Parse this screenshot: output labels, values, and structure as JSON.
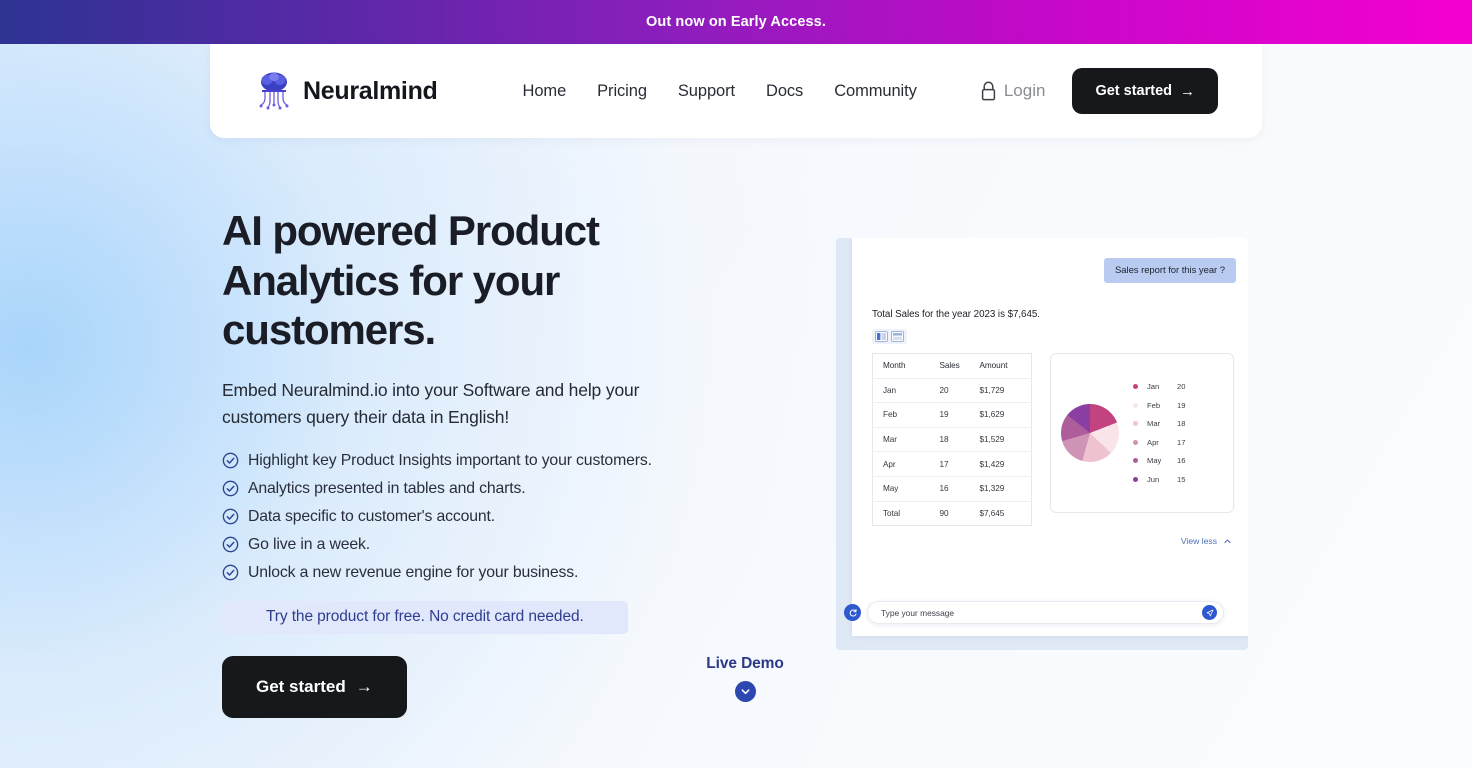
{
  "banner": {
    "text": "Out now on Early Access."
  },
  "header": {
    "brand": "Neuralmind",
    "logo_icon": "brain-circuit-logo",
    "nav": [
      {
        "label": "Home"
      },
      {
        "label": "Pricing"
      },
      {
        "label": "Support"
      },
      {
        "label": "Docs"
      },
      {
        "label": "Community"
      }
    ],
    "login_label": "Login",
    "login_icon": "lock-icon",
    "cta_label": "Get started",
    "cta_arrow": "→"
  },
  "hero": {
    "headline": "AI powered Product Analytics for your customers.",
    "subhead": "Embed Neuralmind.io into your Software and help your customers query their data in English!",
    "features": [
      "Highlight key Product Insights important to your customers.",
      "Analytics presented in tables and charts.",
      "Data specific to customer's account.",
      "Go live in a week.",
      "Unlock a new revenue engine for your business."
    ],
    "promo": "Try the product for free. No credit card needed.",
    "cta_label": "Get started",
    "cta_arrow": "→"
  },
  "live_demo": {
    "label": "Live Demo",
    "scroll_icon": "chevron-down-icon"
  },
  "demo": {
    "user_message": "Sales report for this year ?",
    "answer": "Total Sales for the year 2023 is $7,645.",
    "toggle_chart_icon": "columns-view-icon",
    "toggle_table_icon": "table-view-icon",
    "view_less_label": "View less",
    "view_less_icon": "chevron-up-icon",
    "refresh_icon": "refresh-icon",
    "send_icon": "send-icon",
    "composer_placeholder": "Type your message"
  },
  "chart_data": [
    {
      "type": "table",
      "title": "Total Sales for the year 2023 is $7,645.",
      "columns": [
        "Month",
        "Sales",
        "Amount"
      ],
      "rows": [
        [
          "Jan",
          "20",
          "$1,729"
        ],
        [
          "Feb",
          "19",
          "$1,629"
        ],
        [
          "Mar",
          "18",
          "$1,529"
        ],
        [
          "Apr",
          "17",
          "$1,429"
        ],
        [
          "May",
          "16",
          "$1,329"
        ],
        [
          "Total",
          "90",
          "$7,645"
        ]
      ]
    },
    {
      "type": "pie",
      "title": "",
      "categories": [
        "Jan",
        "Feb",
        "Mar",
        "Apr",
        "May",
        "Jun"
      ],
      "values": [
        20,
        19,
        18,
        17,
        16,
        15
      ],
      "colors": [
        "#c2437f",
        "#f9e4e9",
        "#eec3cf",
        "#cf93b6",
        "#ad5e9a",
        "#8b3fa3"
      ],
      "legend_position": "right"
    }
  ],
  "colors": {
    "banner_start": "#2d3392",
    "banner_end": "#f500d0",
    "cta_dark": "#17181c",
    "accent_blue": "#2d47b0",
    "promo_bg": "#e2e8fb",
    "bubble_bg": "#b9cbf0"
  }
}
